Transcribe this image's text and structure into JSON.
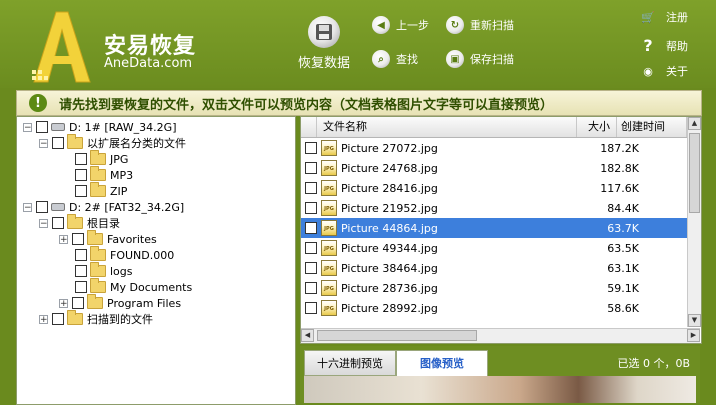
{
  "app": {
    "name": "安易恢复",
    "url": "AneData.com"
  },
  "toolbar": {
    "recover_label": "恢复数据",
    "prev_label": "上一步",
    "rescan_label": "重新扫描",
    "find_label": "查找",
    "save_scan_label": "保存扫描"
  },
  "rightmenu": {
    "register_label": "注册",
    "help_label": "帮助",
    "about_label": "关于"
  },
  "notice": {
    "text": "请先找到要恢复的文件，双击文件可以预览内容（文档表格图片文字等可以直接预览）"
  },
  "tree": {
    "disk1": "D:  1# [RAW_34.2G]",
    "by_ext": "以扩展名分类的文件",
    "jpg": "JPG",
    "mp3": "MP3",
    "zip": "ZIP",
    "disk2": "D:  2# [FAT32_34.2G]",
    "root": "根目录",
    "favorites": "Favorites",
    "found": "FOUND.000",
    "logs": "logs",
    "mydocs": "My Documents",
    "progfiles": "Program Files",
    "scanned": "扫描到的文件"
  },
  "filelist": {
    "col_name": "文件名称",
    "col_size": "大小",
    "col_created": "创建时间",
    "rows": [
      {
        "name": "Picture 27072.jpg",
        "size": "187.2K"
      },
      {
        "name": "Picture 24768.jpg",
        "size": "182.8K"
      },
      {
        "name": "Picture 28416.jpg",
        "size": "117.6K"
      },
      {
        "name": "Picture 21952.jpg",
        "size": "84.4K"
      },
      {
        "name": "Picture 44864.jpg",
        "size": "63.7K"
      },
      {
        "name": "Picture 49344.jpg",
        "size": "63.5K"
      },
      {
        "name": "Picture 38464.jpg",
        "size": "63.1K"
      },
      {
        "name": "Picture 28736.jpg",
        "size": "59.1K"
      },
      {
        "name": "Picture 28992.jpg",
        "size": "58.6K"
      }
    ]
  },
  "preview": {
    "tab_hex": "十六进制预览",
    "tab_image": "图像预览",
    "selected_info": "已选 0 个，0B"
  }
}
